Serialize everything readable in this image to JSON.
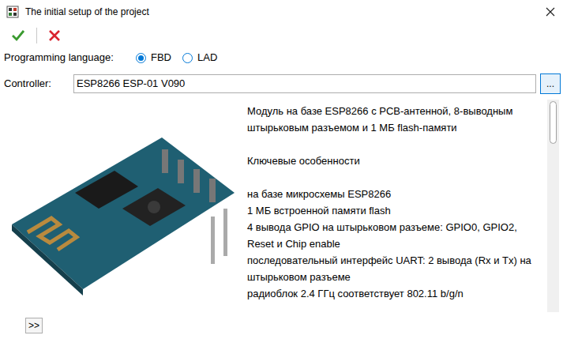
{
  "window": {
    "title": "The initial setup of the project"
  },
  "language": {
    "label": "Programming language:",
    "options": [
      {
        "label": "FBD",
        "selected": true
      },
      {
        "label": "LAD",
        "selected": false
      }
    ]
  },
  "controller": {
    "label": "Controller:",
    "value": "ESP8266 ESP-01 V090",
    "browse": "..."
  },
  "description": {
    "lines": [
      "Модуль на базе ESP8266 с PCB-антенной, 8-выводным",
      "штырьковым разъемом и 1 МБ flash-памяти",
      "",
      "Ключевые особенности",
      "",
      "на базе микросхемы ESP8266",
      "1 МБ встроенной памяти flash",
      "4 вывода GPIO на штырьковом разъеме: GPIO0, GPIO2,",
      "Reset и Chip enable",
      "последовательный интерфейс UART: 2 вывода (Rx и Tx) на",
      "штырьковом разъеме",
      "радиоблок 2.4 ГГц соответствует 802.11 b/g/n"
    ]
  },
  "expand_button": ">>"
}
